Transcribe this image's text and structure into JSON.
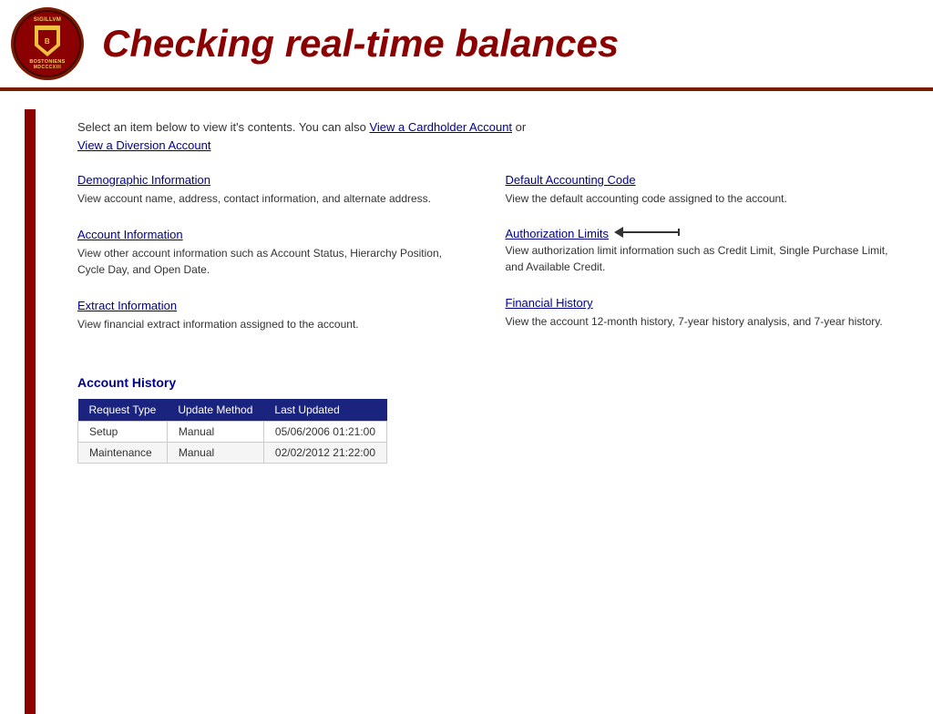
{
  "header": {
    "title": "Checking real-time balances"
  },
  "intro": {
    "text": "Select an item below to view it's contents. You can also ",
    "link1": "View a Cardholder Account",
    "text2": " or",
    "link2": "View a Diversion Account"
  },
  "sections": [
    {
      "id": "demographic-information",
      "link": "Demographic Information",
      "desc": "View account name, address, contact information, and alternate address."
    },
    {
      "id": "default-accounting-code",
      "link": "Default Accounting Code",
      "desc": "View the default accounting code assigned to the account."
    },
    {
      "id": "account-information",
      "link": "Account Information",
      "desc": "View other account information such as Account Status, Hierarchy Position, Cycle Day, and Open Date."
    },
    {
      "id": "authorization-limits",
      "link": "Authorization Limits",
      "desc": "View authorization limit information such as Credit Limit, Single Purchase Limit, and Available Credit.",
      "hasArrow": true
    },
    {
      "id": "extract-information",
      "link": "Extract Information",
      "desc": "View financial extract information assigned to the account."
    },
    {
      "id": "financial-history",
      "link": "Financial History",
      "desc": "View the account 12-month history, 7-year history analysis, and 7-year history."
    }
  ],
  "accountHistory": {
    "title": "Account History",
    "columns": [
      "Request Type",
      "Update Method",
      "Last Updated"
    ],
    "rows": [
      [
        "Setup",
        "Manual",
        "05/06/2006 01:21:00"
      ],
      [
        "Maintenance",
        "Manual",
        "02/02/2012 21:22:00"
      ]
    ]
  }
}
